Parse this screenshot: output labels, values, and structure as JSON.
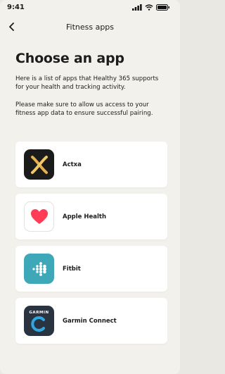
{
  "status_bar": {
    "time": "9:41"
  },
  "nav": {
    "title": "Fitness apps"
  },
  "page": {
    "heading": "Choose an app",
    "intro": "Here is a list of apps that Healthy 365 supports for your health and tracking activity.",
    "note": "Please make sure to allow us access to your fitness app data to ensure successful pairing."
  },
  "apps": [
    {
      "name": "Actxa",
      "icon": "actxa-logo-icon"
    },
    {
      "name": "Apple Health",
      "icon": "apple-health-heart-icon"
    },
    {
      "name": "Fitbit",
      "icon": "fitbit-dots-icon"
    },
    {
      "name": "Garmin Connect",
      "icon": "garmin-connect-icon",
      "logo_text": "GARMIN"
    }
  ],
  "colors": {
    "background": "#f2f1ec",
    "card": "#ffffff",
    "fitbit": "#3fa8b8",
    "actxa_accent": "#e8b04a",
    "apple_heart": "#ff3b55"
  }
}
